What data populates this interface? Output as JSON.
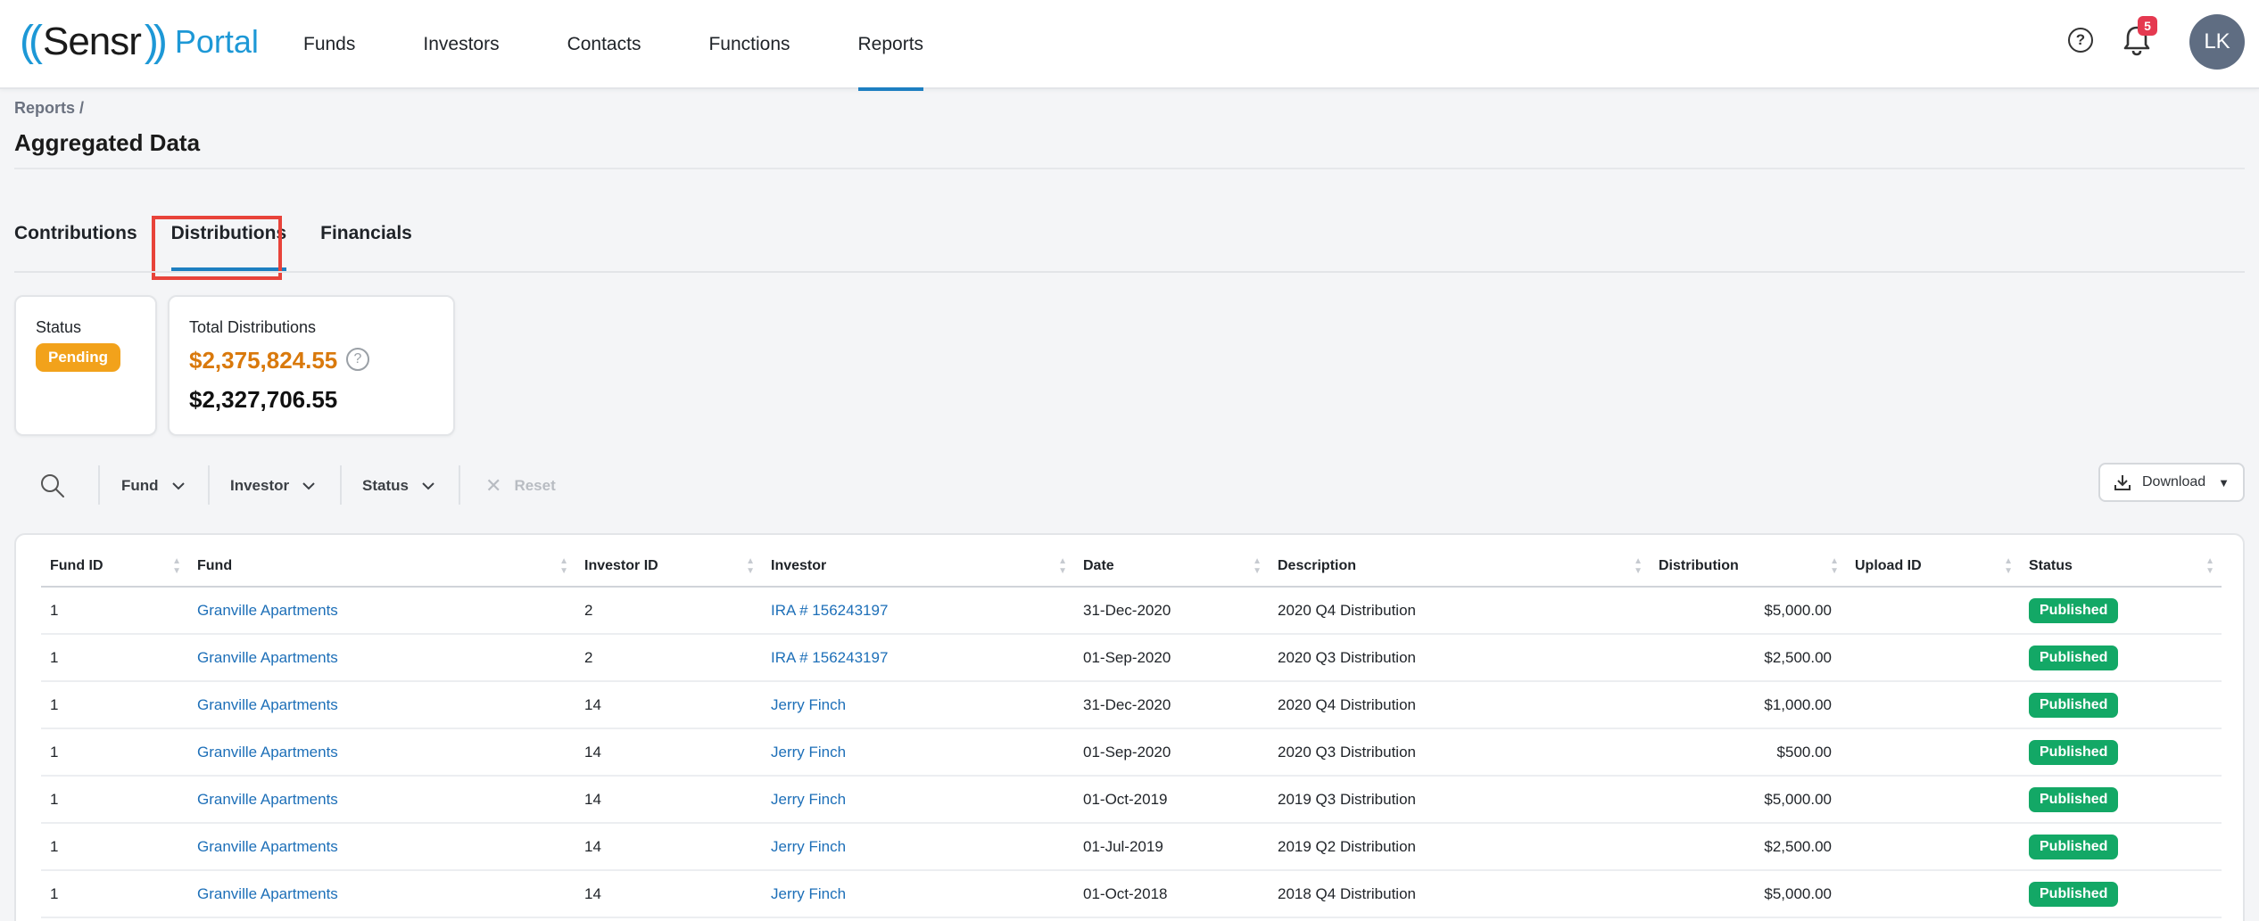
{
  "brand": {
    "logo_left": "((",
    "logo_name": "Sensr",
    "logo_right": "))",
    "logo_product": "Portal"
  },
  "nav": {
    "items": [
      {
        "label": "Funds"
      },
      {
        "label": "Investors"
      },
      {
        "label": "Contacts"
      },
      {
        "label": "Functions"
      },
      {
        "label": "Reports"
      }
    ],
    "active": "Reports",
    "help_icon": "help-circle-icon",
    "notification_icon": "bell-icon",
    "notification_count": "5",
    "avatar_initials": "LK"
  },
  "header": {
    "breadcrumb": "Reports /",
    "title": "Aggregated Data"
  },
  "tabs": {
    "items": [
      {
        "label": "Contributions"
      },
      {
        "label": "Distributions"
      },
      {
        "label": "Financials"
      }
    ],
    "active": "Distributions",
    "highlight_color": "#e8433a"
  },
  "cards": {
    "status_label": "Status",
    "status_value": "Pending",
    "total_label": "Total Distributions",
    "total_pending": "$2,375,824.55",
    "total_published": "$2,327,706.55"
  },
  "filters": {
    "search_icon": "search-icon",
    "fund": "Fund",
    "investor": "Investor",
    "status": "Status",
    "reset": "Reset",
    "download": "Download"
  },
  "table": {
    "columns": [
      "Fund ID",
      "Fund",
      "Investor ID",
      "Investor",
      "Date",
      "Description",
      "Distribution",
      "Upload ID",
      "Status"
    ],
    "rows": [
      {
        "fund_id": "1",
        "fund": "Granville Apartments",
        "investor_id": "2",
        "investor": "IRA # 156243197",
        "date": "31-Dec-2020",
        "description": "2020 Q4 Distribution",
        "distribution": "$5,000.00",
        "upload_id": "",
        "status": "Published"
      },
      {
        "fund_id": "1",
        "fund": "Granville Apartments",
        "investor_id": "2",
        "investor": "IRA # 156243197",
        "date": "01-Sep-2020",
        "description": "2020 Q3 Distribution",
        "distribution": "$2,500.00",
        "upload_id": "",
        "status": "Published"
      },
      {
        "fund_id": "1",
        "fund": "Granville Apartments",
        "investor_id": "14",
        "investor": "Jerry Finch",
        "date": "31-Dec-2020",
        "description": "2020 Q4 Distribution",
        "distribution": "$1,000.00",
        "upload_id": "",
        "status": "Published"
      },
      {
        "fund_id": "1",
        "fund": "Granville Apartments",
        "investor_id": "14",
        "investor": "Jerry Finch",
        "date": "01-Sep-2020",
        "description": "2020 Q3 Distribution",
        "distribution": "$500.00",
        "upload_id": "",
        "status": "Published"
      },
      {
        "fund_id": "1",
        "fund": "Granville Apartments",
        "investor_id": "14",
        "investor": "Jerry Finch",
        "date": "01-Oct-2019",
        "description": "2019 Q3 Distribution",
        "distribution": "$5,000.00",
        "upload_id": "",
        "status": "Published"
      },
      {
        "fund_id": "1",
        "fund": "Granville Apartments",
        "investor_id": "14",
        "investor": "Jerry Finch",
        "date": "01-Jul-2019",
        "description": "2019 Q2 Distribution",
        "distribution": "$2,500.00",
        "upload_id": "",
        "status": "Published"
      },
      {
        "fund_id": "1",
        "fund": "Granville Apartments",
        "investor_id": "14",
        "investor": "Jerry Finch",
        "date": "01-Oct-2018",
        "description": "2018 Q4 Distribution",
        "distribution": "$5,000.00",
        "upload_id": "",
        "status": "Published"
      }
    ]
  },
  "colors": {
    "accent": "#1d98d6",
    "link": "#1d6fb8",
    "pending": "#f2a21b",
    "published": "#13a866",
    "total_pending_text": "#d9790c"
  }
}
